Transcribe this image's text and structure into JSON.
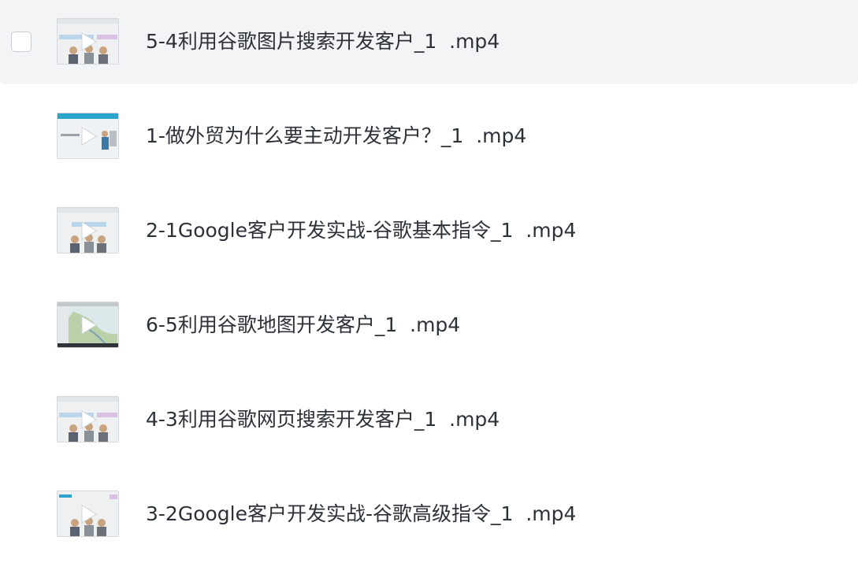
{
  "files": [
    {
      "name": "5-4利用谷歌图片搜索开发客户_1  .mp4",
      "thumb_icon": "video-thumbnail-icon",
      "selected": false
    },
    {
      "name": "1-做外贸为什么要主动开发客户？_1  .mp4",
      "thumb_icon": "video-thumbnail-icon"
    },
    {
      "name": "2-1Google客户开发实战-谷歌基本指令_1  .mp4",
      "thumb_icon": "video-thumbnail-icon"
    },
    {
      "name": "6-5利用谷歌地图开发客户_1  .mp4",
      "thumb_icon": "video-thumbnail-icon"
    },
    {
      "name": "4-3利用谷歌网页搜索开发客户_1  .mp4",
      "thumb_icon": "video-thumbnail-icon"
    },
    {
      "name": "3-2Google客户开发实战-谷歌高级指令_1  .mp4",
      "thumb_icon": "video-thumbnail-icon"
    }
  ],
  "colors": {
    "hover_row": "#f2f4f6",
    "text": "#2c3138",
    "checkbox_border": "#c8ccd2"
  }
}
